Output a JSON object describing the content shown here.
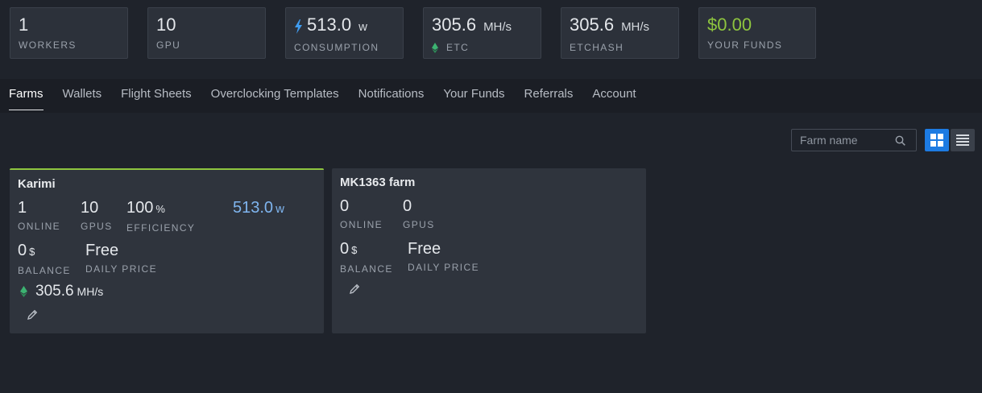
{
  "stats": {
    "workers": {
      "value": "1",
      "label": "WORKERS"
    },
    "gpu": {
      "value": "10",
      "label": "GPU"
    },
    "consumption": {
      "value": "513.0",
      "unit": "w",
      "label": "CONSUMPTION",
      "icon": "lightning-icon"
    },
    "etc": {
      "value": "305.6",
      "unit": "MH/s",
      "label": "ETC",
      "icon": "ethereum-icon"
    },
    "etchash": {
      "value": "305.6",
      "unit": "MH/s",
      "label": "ETCHASH"
    },
    "funds": {
      "value": "$0.00",
      "label": "YOUR FUNDS"
    }
  },
  "tabs": [
    {
      "label": "Farms",
      "active": true
    },
    {
      "label": "Wallets"
    },
    {
      "label": "Flight Sheets"
    },
    {
      "label": "Overclocking Templates"
    },
    {
      "label": "Notifications"
    },
    {
      "label": "Your Funds"
    },
    {
      "label": "Referrals"
    },
    {
      "label": "Account"
    }
  ],
  "search": {
    "placeholder": "Farm name",
    "value": ""
  },
  "colors": {
    "accent": "#1d7be2",
    "green": "#8ec53f",
    "power": "#7fb5ef"
  },
  "farms": [
    {
      "name": "Karimi",
      "online": {
        "value": "1",
        "label": "ONLINE"
      },
      "gpus": {
        "value": "10",
        "label": "GPUS"
      },
      "efficiency": {
        "value": "100",
        "unit": "%",
        "label": "EFFICIENCY"
      },
      "power": {
        "value": "513.0",
        "unit": "w"
      },
      "balance": {
        "value": "0",
        "unit": "$",
        "label": "BALANCE"
      },
      "daily_price": {
        "value": "Free",
        "label": "DAILY PRICE"
      },
      "hashrate": {
        "value": "305.6",
        "unit": "MH/s"
      }
    },
    {
      "name": "MK1363 farm",
      "online": {
        "value": "0",
        "label": "ONLINE"
      },
      "gpus": {
        "value": "0",
        "label": "GPUS"
      },
      "balance": {
        "value": "0",
        "unit": "$",
        "label": "BALANCE"
      },
      "daily_price": {
        "value": "Free",
        "label": "DAILY PRICE"
      }
    }
  ]
}
